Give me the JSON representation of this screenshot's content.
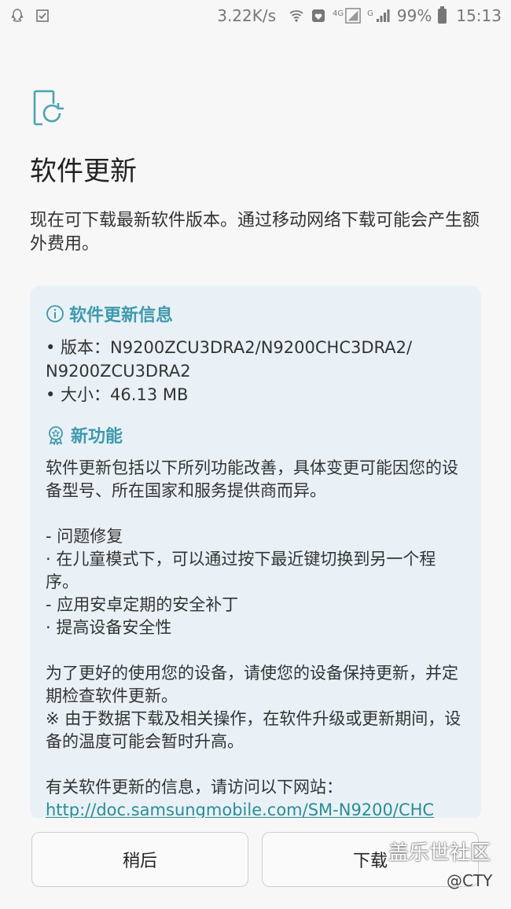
{
  "status_bar": {
    "speed": "3.22K/s",
    "net1": "4G",
    "net2": "G",
    "battery": "99%",
    "time": "15:13"
  },
  "header": {
    "title": "软件更新",
    "description": "现在可下载最新软件版本。通过移动网络下载可能会产生额外费用。"
  },
  "info_section": {
    "heading": "软件更新信息",
    "version_line1": "• 版本：N9200ZCU3DRA2/N9200CHC3DRA2/",
    "version_line2": "N9200ZCU3DRA2",
    "size_line": "• 大小：46.13 MB"
  },
  "features_section": {
    "heading": "新功能",
    "body": "软件更新包括以下所列功能改善，具体变更可能因您的设备型号、所在国家和服务提供商而异。\n\n- 问题修复\n· 在儿童模式下，可以通过按下最近键切换到另一个程序。\n- 应用安卓定期的安全补丁\n· 提高设备安全性\n\n为了更好的使用您的设备，请使您的设备保持更新，并定期检查软件更新。\n※ 由于数据下载及相关操作，在软件升级或更新期间，设备的温度可能会暂时升高。\n\n有关软件更新的信息，请访问以下网站：",
    "link": "http://doc.samsungmobile.com/SM-N9200/CHC"
  },
  "buttons": {
    "later": "稍后",
    "download": "下载"
  },
  "watermark": {
    "text": "盖乐世社区",
    "sub": "@CTY"
  },
  "colors": {
    "accent": "#3e9aac",
    "card_bg": "#e9f1f6",
    "link": "#2a8d96"
  }
}
